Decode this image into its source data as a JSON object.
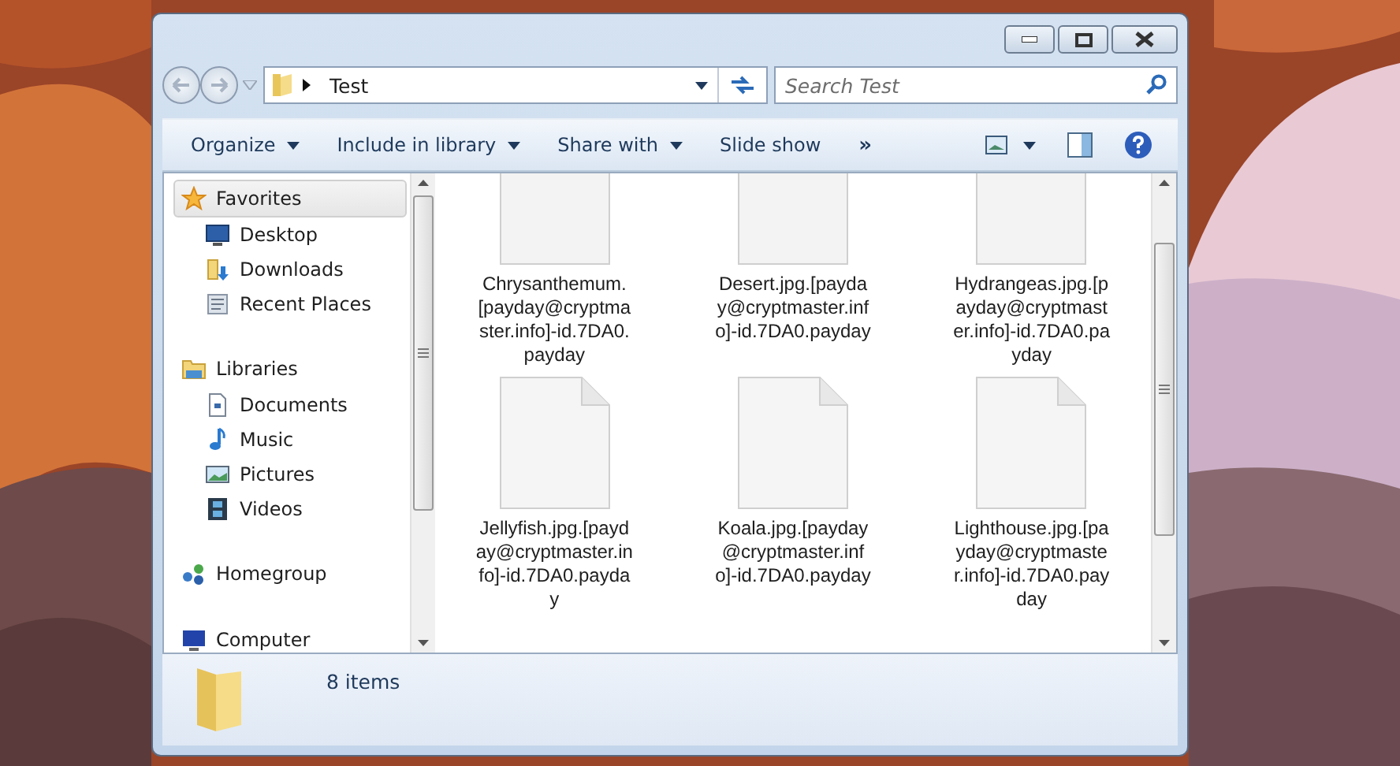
{
  "address_bar": {
    "breadcrumb": "Test"
  },
  "search": {
    "placeholder": "Search Test"
  },
  "toolbar": {
    "items": [
      {
        "label": "Organize",
        "dropdown": true
      },
      {
        "label": "Include in library",
        "dropdown": true
      },
      {
        "label": "Share with",
        "dropdown": true
      },
      {
        "label": "Slide show",
        "dropdown": false
      }
    ],
    "overflow": "»"
  },
  "navigation": [
    {
      "label": "Favorites",
      "selected": true,
      "children": [
        {
          "label": "Desktop",
          "selected": false
        },
        {
          "label": "Downloads",
          "selected": false
        },
        {
          "label": "Recent Places",
          "selected": false
        }
      ]
    },
    {
      "label": "Libraries",
      "selected": false,
      "children": [
        {
          "label": "Documents",
          "selected": false
        },
        {
          "label": "Music",
          "selected": false
        },
        {
          "label": "Pictures",
          "selected": false
        },
        {
          "label": "Videos",
          "selected": false
        }
      ]
    },
    {
      "label": "Homegroup",
      "selected": false
    },
    {
      "label": "Computer",
      "selected": false
    }
  ],
  "files": [
    {
      "name": "Chrysanthemum.[payday@cryptmaster.info]-id.7DA0.payday"
    },
    {
      "name": "Desert.jpg.[payday@cryptmaster.info]-id.7DA0.payday"
    },
    {
      "name": "Hydrangeas.jpg.[payday@cryptmaster.info]-id.7DA0.payday"
    },
    {
      "name": "Jellyfish.jpg.[payday@cryptmaster.info]-id.7DA0.payday"
    },
    {
      "name": "Koala.jpg.[payday@cryptmaster.info]-id.7DA0.payday"
    },
    {
      "name": "Lighthouse.jpg.[payday@cryptmaster.info]-id.7DA0.payday"
    }
  ],
  "status_bar": {
    "item_count": "8 items"
  }
}
